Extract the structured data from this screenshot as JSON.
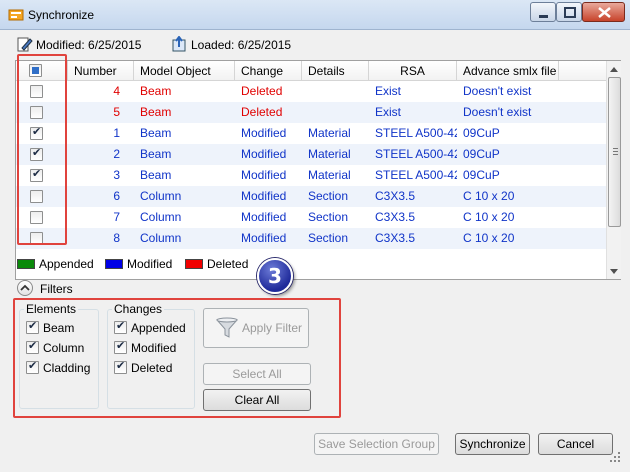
{
  "window": {
    "title": "Synchronize",
    "app_icon": "sync-app-icon"
  },
  "dates": {
    "modified_label": "Modified: 6/25/2015",
    "loaded_label": "Loaded: 6/25/2015"
  },
  "table": {
    "columns": [
      "Number",
      "Model Object",
      "Change",
      "Details",
      "RSA",
      "Advance smlx file"
    ],
    "rows": [
      {
        "checked": false,
        "number": "4",
        "model_object": "Beam",
        "change": "Deleted",
        "details": "",
        "rsa": "Exist",
        "advance": "Doesn't exist",
        "color": "red"
      },
      {
        "checked": false,
        "number": "5",
        "model_object": "Beam",
        "change": "Deleted",
        "details": "",
        "rsa": "Exist",
        "advance": "Doesn't exist",
        "color": "red"
      },
      {
        "checked": true,
        "number": "1",
        "model_object": "Beam",
        "change": "Modified",
        "details": "Material",
        "rsa": "STEEL A500-42",
        "advance": "09CuP",
        "color": "blue"
      },
      {
        "checked": true,
        "number": "2",
        "model_object": "Beam",
        "change": "Modified",
        "details": "Material",
        "rsa": "STEEL A500-42",
        "advance": "09CuP",
        "color": "blue"
      },
      {
        "checked": true,
        "number": "3",
        "model_object": "Beam",
        "change": "Modified",
        "details": "Material",
        "rsa": "STEEL A500-42",
        "advance": "09CuP",
        "color": "blue"
      },
      {
        "checked": false,
        "number": "6",
        "model_object": "Column",
        "change": "Modified",
        "details": "Section",
        "rsa": "C3X3.5",
        "advance": "C 10 x 20",
        "color": "blue"
      },
      {
        "checked": false,
        "number": "7",
        "model_object": "Column",
        "change": "Modified",
        "details": "Section",
        "rsa": "C3X3.5",
        "advance": "C 10 x 20",
        "color": "blue"
      },
      {
        "checked": false,
        "number": "8",
        "model_object": "Column",
        "change": "Modified",
        "details": "Section",
        "rsa": "C3X3.5",
        "advance": "C 10 x 20",
        "color": "blue"
      }
    ]
  },
  "legend": [
    {
      "label": "Appended",
      "color": "#0a8a0a"
    },
    {
      "label": "Modified",
      "color": "#0000e6"
    },
    {
      "label": "Deleted",
      "color": "#f00000"
    }
  ],
  "badge": {
    "text": "3"
  },
  "filters": {
    "toggle_label": "Filters",
    "elements": {
      "label": "Elements",
      "options": [
        {
          "label": "Beam",
          "checked": true
        },
        {
          "label": "Column",
          "checked": true
        },
        {
          "label": "Cladding",
          "checked": true
        }
      ]
    },
    "changes": {
      "label": "Changes",
      "options": [
        {
          "label": "Appended",
          "checked": true
        },
        {
          "label": "Modified",
          "checked": true
        },
        {
          "label": "Deleted",
          "checked": true
        }
      ]
    },
    "apply_label": "Apply Filter",
    "select_all_label": "Select All",
    "clear_all_label": "Clear All"
  },
  "footer": {
    "save_group_label": "Save Selection Group",
    "synchronize_label": "Synchronize",
    "cancel_label": "Cancel"
  },
  "colors": {
    "red_text": "#e00000",
    "blue_text": "#1034c8",
    "highlight_box": "#e0433d"
  }
}
